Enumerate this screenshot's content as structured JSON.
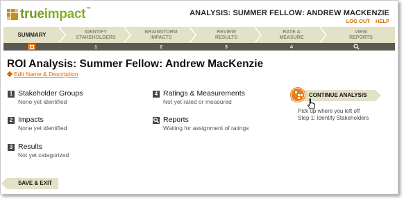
{
  "brand": {
    "name_part1": "true",
    "name_part2": "impact",
    "trademark": "™"
  },
  "header": {
    "title": "ANALYSIS: SUMMER FELLOW: ANDREW MACKENZIE",
    "logout": "LOG OUT",
    "help": "HELP"
  },
  "steps": [
    {
      "label_line1": "SUMMARY",
      "label_line2": "",
      "number": ""
    },
    {
      "label_line1": "IDENTIFY",
      "label_line2": "STAKEHOLDERS",
      "number": "1"
    },
    {
      "label_line1": "BRAINSTORM",
      "label_line2": "IMPACTS",
      "number": "2"
    },
    {
      "label_line1": "REVIEW",
      "label_line2": "RESULTS",
      "number": "3"
    },
    {
      "label_line1": "RATE &",
      "label_line2": "MEASURE",
      "number": "4"
    },
    {
      "label_line1": "VIEW",
      "label_line2": "REPORTS",
      "number": ""
    }
  ],
  "page": {
    "title": "ROI Analysis: Summer Fellow: Andrew MacKenzie",
    "edit_link": "Edit Name & Description"
  },
  "items": [
    {
      "number": "1",
      "title": "Stakeholder Groups",
      "status": "None yet identified"
    },
    {
      "number": "2",
      "title": "Impacts",
      "status": "None yet identified"
    },
    {
      "number": "3",
      "title": "Results",
      "status": "Not yet categorized"
    },
    {
      "number": "4",
      "title": "Ratings & Measurements",
      "status": "Not yet rated or measured"
    },
    {
      "number": "",
      "title": "Reports",
      "status": "Waiting for assignment of ratings"
    }
  ],
  "continue": {
    "label": "CONTINUE ANALYSIS",
    "line1": "Pick up where you left off",
    "line2": "Step 1: Identify Stakeholders"
  },
  "save_exit": "SAVE & EXIT",
  "colors": {
    "accent": "#f07a17",
    "brand_green": "#8aac2b",
    "step_bg": "#e3e1c6",
    "step_bar_dark": "#5a5a50",
    "link": "#d46a00"
  }
}
